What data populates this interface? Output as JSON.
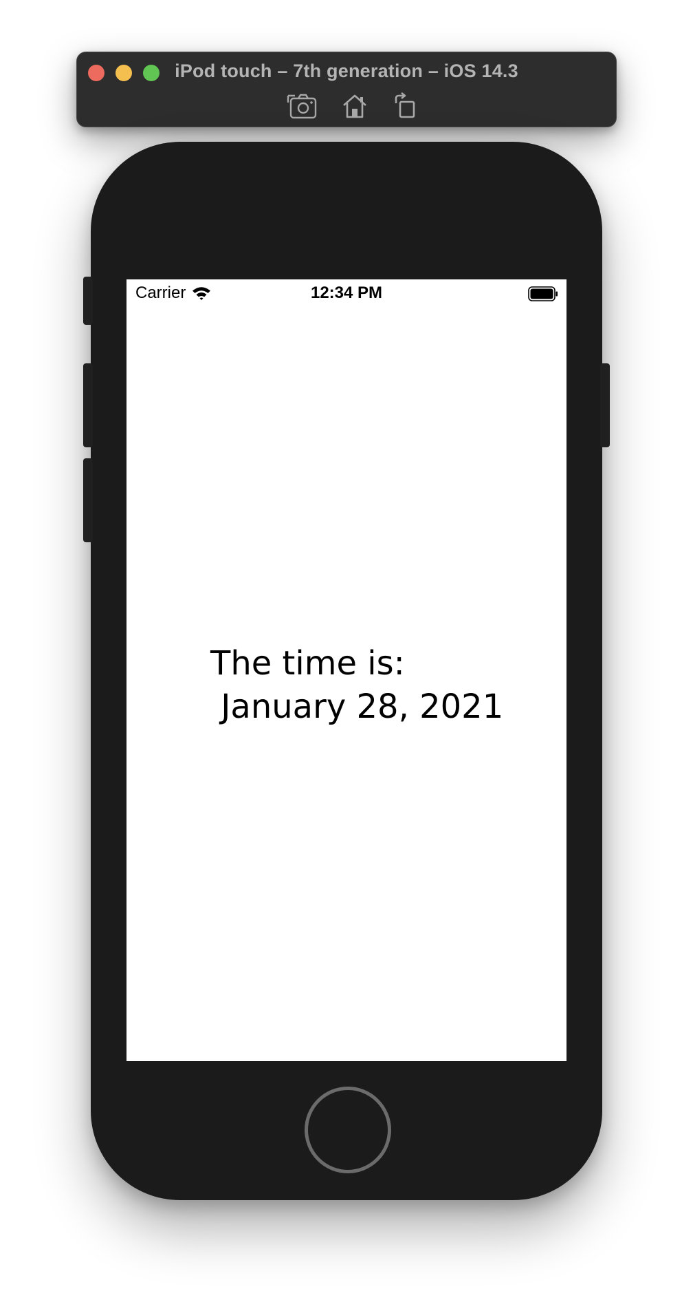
{
  "window": {
    "title": "iPod touch – 7th generation – iOS 14.3"
  },
  "toolbar": {
    "items": [
      {
        "name": "screenshot-icon"
      },
      {
        "name": "home-icon"
      },
      {
        "name": "rotate-icon"
      }
    ]
  },
  "status_bar": {
    "carrier": "Carrier",
    "time": "12:34 PM",
    "battery_icon": "battery-full-icon",
    "wifi_icon": "wifi-icon"
  },
  "app": {
    "label": "The time is:",
    "date": " January 28, 2021"
  },
  "colors": {
    "close": "#ed6a5e",
    "minimize": "#f5bf4f",
    "zoom": "#61c554",
    "device_body": "#1b1b1b",
    "screen_bg": "#ffffff",
    "titlebar_bg": "#2d2d2d"
  }
}
